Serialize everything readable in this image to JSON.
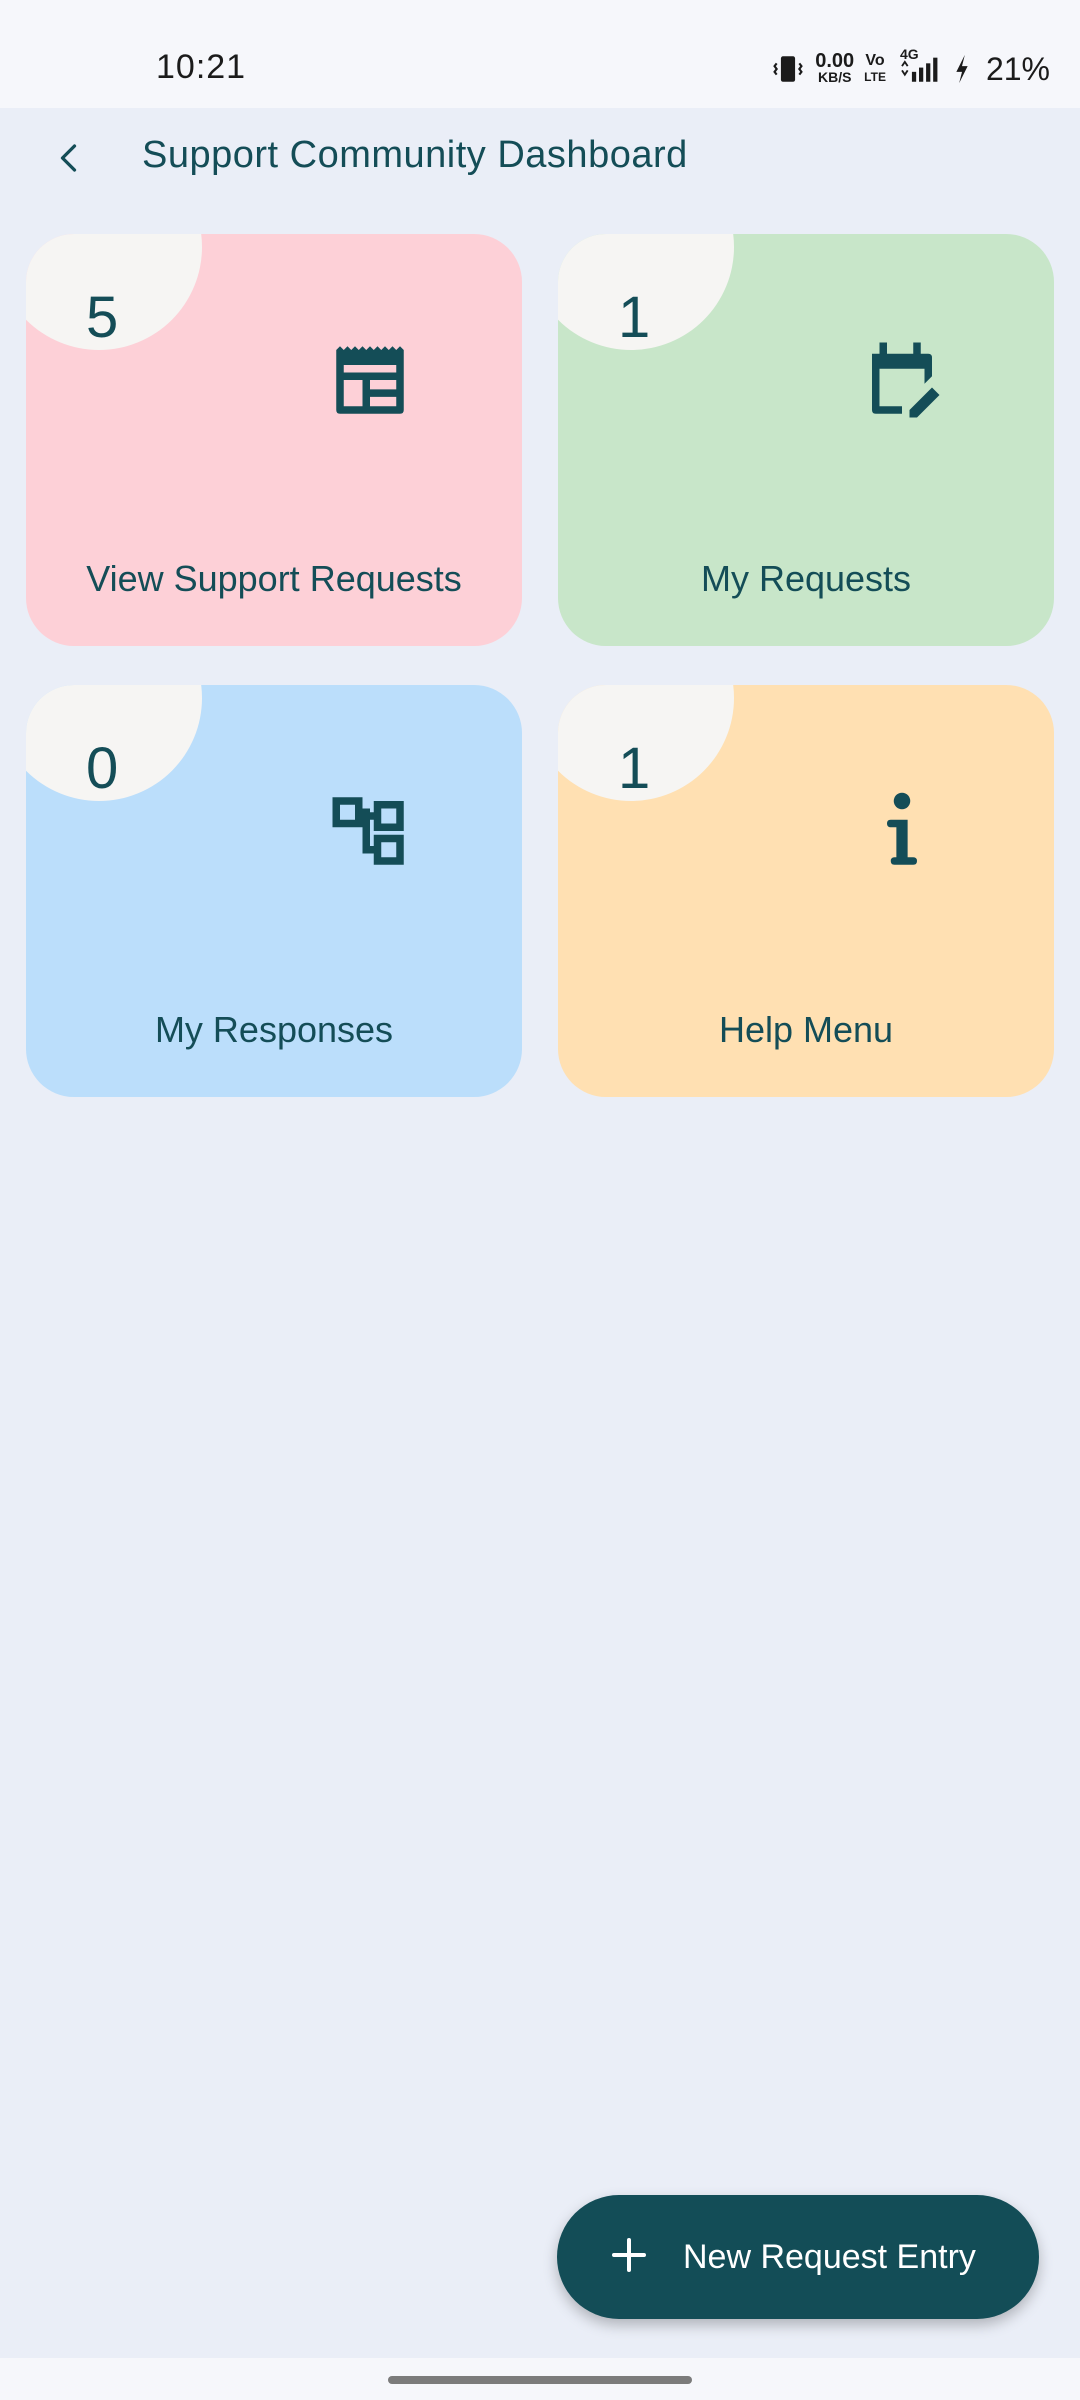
{
  "status_bar": {
    "time": "10:21",
    "net_speed_value": "0.00",
    "net_speed_unit": "KB/S",
    "volte_top": "Vo",
    "volte_bottom": "LTE",
    "network": "4G",
    "battery": "21%"
  },
  "app_bar": {
    "title": "Support Community Dashboard",
    "back_icon": "chevron-left-icon"
  },
  "cards": [
    {
      "count": "5",
      "label": "View Support Requests",
      "icon": "table-icon",
      "color": "#fdd0d7"
    },
    {
      "count": "1",
      "label": "My Requests",
      "icon": "calendar-edit-icon",
      "color": "#c8e6c9"
    },
    {
      "count": "0",
      "label": "My Responses",
      "icon": "hierarchy-icon",
      "color": "#bbdefb"
    },
    {
      "count": "1",
      "label": "Help Menu",
      "icon": "info-icon",
      "color": "#ffe0b2"
    }
  ],
  "fab": {
    "label": "New Request Entry",
    "icon": "plus-icon",
    "color": "#134d57"
  },
  "colors": {
    "background": "#eaeef7",
    "primary_text": "#144d57"
  }
}
